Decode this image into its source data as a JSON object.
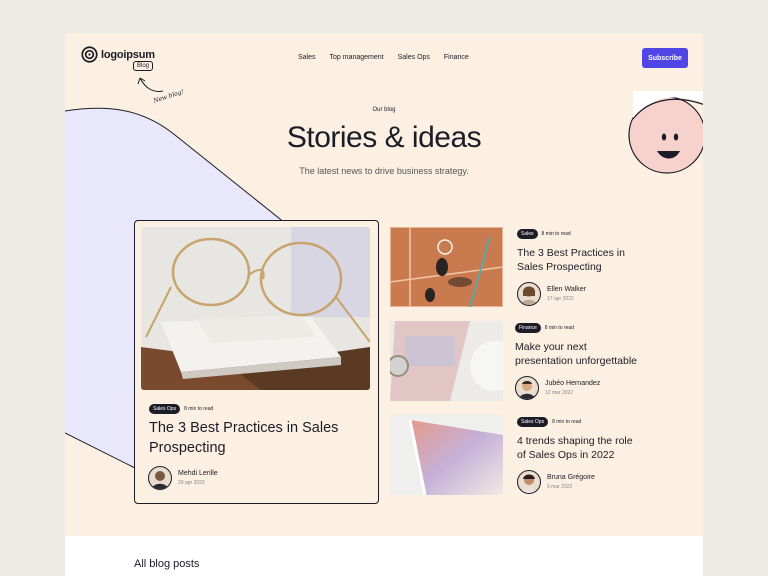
{
  "header": {
    "logo_text": "logoipsum",
    "blog_tag": "Blog",
    "annotation": "New blog!",
    "nav": [
      "Sales",
      "Top management",
      "Sales Ops",
      "Finance"
    ],
    "subscribe_label": "Subscribe"
  },
  "hero": {
    "eyebrow": "Our blog",
    "title": "Stories & ideas",
    "subtitle": "The latest news to drive business strategy."
  },
  "featured": {
    "category": "Sales Ops",
    "read_time": "8 min to read",
    "title": "The 3 Best Practices in Sales Prospecting",
    "author": "Mehdi Lerille",
    "date": "20 apr 2022"
  },
  "posts": [
    {
      "category": "Sales",
      "read_time": "8 min to read",
      "title": "The 3 Best Practices in Sales Prospecting",
      "author": "Ellen Walker",
      "date": "17 apr 2022"
    },
    {
      "category": "Finance",
      "read_time": "8 min to read",
      "title": "Make your next presentation unforgettable",
      "author": "Jubéo Hernandez",
      "date": "12 mar 2022"
    },
    {
      "category": "Sales Ops",
      "read_time": "8 min to read",
      "title": "4 trends shaping the role of Sales Ops in 2022",
      "author": "Bruna Grégoire",
      "date": "9 mar 2022"
    }
  ],
  "bottom": {
    "heading": "All blog posts"
  },
  "colors": {
    "accent": "#4f46e5",
    "background": "#fbf0e1",
    "ink": "#1c1c28"
  }
}
